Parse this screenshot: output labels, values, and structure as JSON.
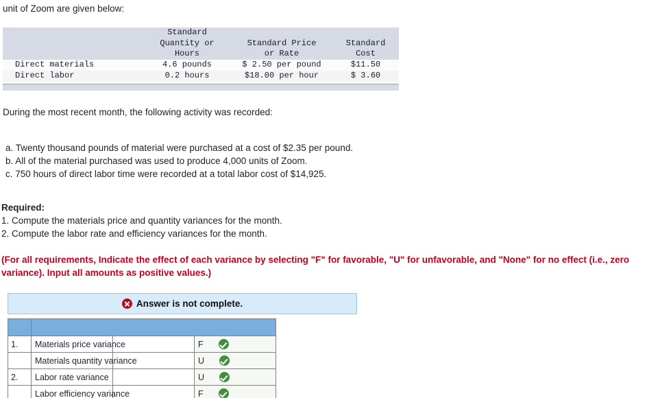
{
  "intro": {
    "line": "unit of Zoom are given below:"
  },
  "standard_table": {
    "headers": {
      "blank": "",
      "quantity": [
        "Standard",
        "Quantity or",
        "Hours"
      ],
      "price": [
        "Standard Price",
        "or Rate"
      ],
      "cost": [
        "Standard",
        "Cost"
      ]
    },
    "rows": [
      {
        "label": "Direct materials",
        "quantity": "4.6 pounds",
        "price": "$ 2.50 per pound",
        "cost": "$11.50"
      },
      {
        "label": "Direct labor",
        "quantity": "0.2 hours",
        "price": "$18.00 per hour",
        "cost": "$ 3.60"
      }
    ]
  },
  "body": {
    "during": "During the most recent month, the following activity was recorded:",
    "item_a": "a. Twenty thousand pounds of material were purchased at a cost of $2.35 per pound.",
    "item_b": "b. All of the material purchased was used to produce 4,000 units of Zoom.",
    "item_c": "c. 750 hours of direct labor time were recorded at a total labor cost of $14,925.",
    "required_title": "Required:",
    "required_1": "1. Compute the materials price and quantity variances for the month.",
    "required_2": "2. Compute the labor rate and efficiency variances for the month.",
    "note": "(For all requirements, Indicate the effect of each variance by selecting \"F\" for favorable, \"U\" for unfavorable, and \"None\" for no effect (i.e., zero variance). Input all amounts as positive values.)"
  },
  "answer_banner": {
    "text": "Answer is not complete.",
    "icon": "x-circle-icon",
    "background_color": "#d7ebfa",
    "icon_color": "#b40d1e"
  },
  "answer_table": {
    "header_color": "#7aaedc",
    "headers": [
      "",
      ""
    ],
    "rows": [
      {
        "num": "1.",
        "label": "Materials price variance",
        "value": "",
        "flag": "F",
        "status": "correct"
      },
      {
        "num": "",
        "label": "Materials quantity variance",
        "value": "",
        "flag": "U",
        "status": "correct"
      },
      {
        "num": "2.",
        "label": "Labor rate variance",
        "value": "",
        "flag": "U",
        "status": "correct"
      },
      {
        "num": "",
        "label": "Labor efficiency variance",
        "value": "",
        "flag": "F",
        "status": "correct"
      }
    ]
  }
}
